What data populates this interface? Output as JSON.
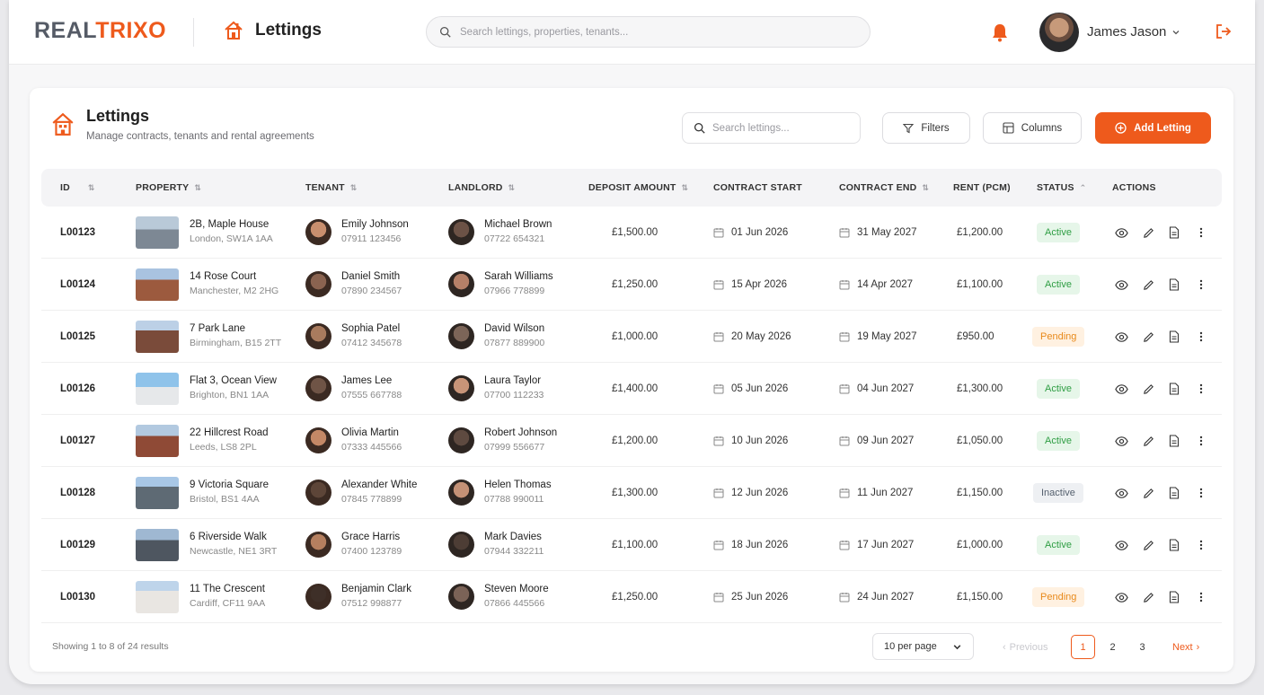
{
  "app": {
    "brand_a": "REAL",
    "brand_b": "TRIX",
    "brand_c": "O",
    "page": "Lettings",
    "brand_color": "#ee5a1c"
  },
  "header": {
    "search_placeholder": "Search lettings, properties, tenants...",
    "user_name": "James Jason",
    "icons": [
      "bell-icon",
      "chevron-down-icon",
      "logout-icon"
    ]
  },
  "card": {
    "title": "Lettings",
    "subtitle": "Manage contracts, tenants and rental agreements",
    "search_placeholder": "Search lettings...",
    "filters_label": "Filters",
    "columns_label": "Columns",
    "add_label": "Add Letting"
  },
  "table": {
    "headers": [
      "ID",
      "PROPERTY",
      "TENANT",
      "LANDLORD",
      "DEPOSIT AMOUNT",
      "CONTRACT START",
      "CONTRACT END",
      "RENT (PCM)",
      "STATUS",
      "ACTIONS"
    ],
    "rows": [
      {
        "id": "L00123",
        "property": "2B, Maple House",
        "address": "London, SW1A 1AA",
        "tenant": "Emily Johnson",
        "tenant_phone": "07911 123456",
        "landlord": "Michael Brown",
        "landlord_phone": "07722 654321",
        "deposit": "£1,500.00",
        "start": "01 Jun 2026",
        "end": "31 May 2027",
        "rent": "£1,200.00",
        "status": "Active"
      },
      {
        "id": "L00124",
        "property": "14 Rose Court",
        "address": "Manchester, M2 2HG",
        "tenant": "Daniel Smith",
        "tenant_phone": "07890 234567",
        "landlord": "Sarah Williams",
        "landlord_phone": "07966 778899",
        "deposit": "£1,250.00",
        "start": "15 Apr 2026",
        "end": "14 Apr 2027",
        "rent": "£1,100.00",
        "status": "Active"
      },
      {
        "id": "L00125",
        "property": "7 Park Lane",
        "address": "Birmingham, B15 2TT",
        "tenant": "Sophia Patel",
        "tenant_phone": "07412 345678",
        "landlord": "David Wilson",
        "landlord_phone": "07877 889900",
        "deposit": "£1,000.00",
        "start": "20 May 2026",
        "end": "19 May 2027",
        "rent": "£950.00",
        "status": "Pending"
      },
      {
        "id": "L00126",
        "property": "Flat 3, Ocean View",
        "address": "Brighton, BN1 1AA",
        "tenant": "James Lee",
        "tenant_phone": "07555 667788",
        "landlord": "Laura Taylor",
        "landlord_phone": "07700 112233",
        "deposit": "£1,400.00",
        "start": "05 Jun 2026",
        "end": "04 Jun 2027",
        "rent": "£1,300.00",
        "status": "Active"
      },
      {
        "id": "L00127",
        "property": "22 Hillcrest Road",
        "address": "Leeds, LS8 2PL",
        "tenant": "Olivia Martin",
        "tenant_phone": "07333 445566",
        "landlord": "Robert Johnson",
        "landlord_phone": "07999 556677",
        "deposit": "£1,200.00",
        "start": "10 Jun 2026",
        "end": "09 Jun 2027",
        "rent": "£1,050.00",
        "status": "Active"
      },
      {
        "id": "L00128",
        "property": "9 Victoria Square",
        "address": "Bristol, BS1 4AA",
        "tenant": "Alexander White",
        "tenant_phone": "07845 778899",
        "landlord": "Helen Thomas",
        "landlord_phone": "07788 990011",
        "deposit": "£1,300.00",
        "start": "12 Jun 2026",
        "end": "11 Jun 2027",
        "rent": "£1,150.00",
        "status": "Inactive"
      },
      {
        "id": "L00129",
        "property": "6 Riverside Walk",
        "address": "Newcastle, NE1 3RT",
        "tenant": "Grace Harris",
        "tenant_phone": "07400 123789",
        "landlord": "Mark Davies",
        "landlord_phone": "07944 332211",
        "deposit": "£1,100.00",
        "start": "18 Jun 2026",
        "end": "17 Jun 2027",
        "rent": "£1,000.00",
        "status": "Active"
      },
      {
        "id": "L00130",
        "property": "11 The Crescent",
        "address": "Cardiff, CF11 9AA",
        "tenant": "Benjamin Clark",
        "tenant_phone": "07512 998877",
        "landlord": "Steven Moore",
        "landlord_phone": "07866 445566",
        "deposit": "£1,250.00",
        "start": "25 Jun 2026",
        "end": "24 Jun 2027",
        "rent": "£1,150.00",
        "status": "Pending"
      }
    ]
  },
  "footer": {
    "summary": "Showing 1 to 8 of 24 results",
    "per_page": "10 per page",
    "prev": "Previous",
    "pages": [
      "1",
      "2",
      "3"
    ],
    "current_page": "1",
    "next": "Next"
  }
}
